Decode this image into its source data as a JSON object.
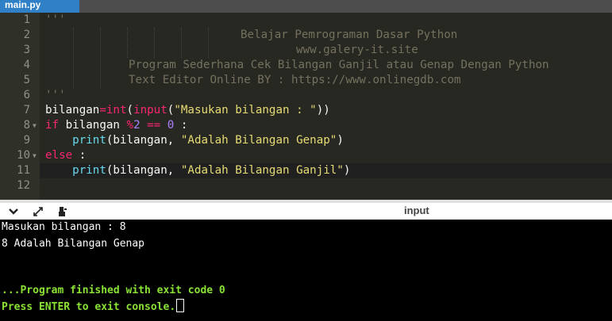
{
  "tab": {
    "filename": "main.py"
  },
  "editor": {
    "line_numbers": [
      "1",
      "2",
      "3",
      "4",
      "5",
      "6",
      "7",
      "8",
      "9",
      "10",
      "11",
      "12"
    ],
    "lines": {
      "l1": "'''",
      "l2": "Belajar Pemrograman Dasar Python",
      "l3": "www.galery-it.site",
      "l4": "Program Sederhana Cek Bilangan Ganjil atau Genap Dengan Python",
      "l5": "Text Editor Online BY : https://www.onlinegdb.com",
      "l6": "'''",
      "l7": {
        "var": "bilangan",
        "op": "=",
        "fn1": "int",
        "p1": "(",
        "fn2": "input",
        "p2": "(",
        "str": "\"Masukan bilangan : \"",
        "p3": "))"
      },
      "l8": {
        "kw": "if",
        "var": " bilangan ",
        "op": "%",
        "num1": "2",
        "mid": " == ",
        "num2": "0",
        "end": " :"
      },
      "l9": {
        "indent": "    ",
        "fn": "print",
        "args": "(bilangan, ",
        "str": "\"Adalah Bilangan Genap\"",
        "end": ")"
      },
      "l10": {
        "kw": "else",
        "end": " :"
      },
      "l11": {
        "indent": "    ",
        "fn": "print",
        "args": "(bilangan, ",
        "str": "\"Adalah Bilangan Ganjil\"",
        "end": ")"
      }
    }
  },
  "console_toolbar": {
    "title": "input",
    "collapse_icon": "chevron-down-icon",
    "expand_icon": "expand-arrows-icon",
    "clear_icon": "clear-console-icon"
  },
  "console": {
    "line1": "Masukan bilangan : 8",
    "line2": "8 Adalah Bilangan Genap",
    "line3": "...Program finished with exit code 0",
    "line4": "Press ENTER to exit console."
  }
}
